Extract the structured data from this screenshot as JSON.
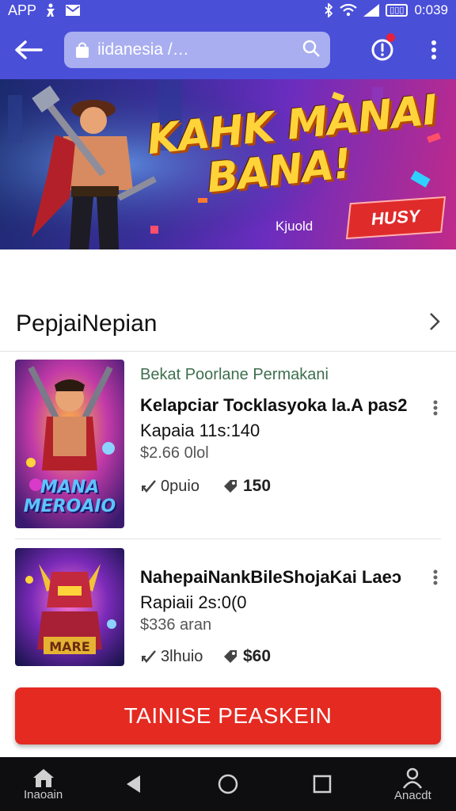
{
  "status_bar": {
    "app_label": "APP",
    "time": "0:039",
    "battery_label": "▯▯▯"
  },
  "toolbar": {
    "search_value": "iidanesia /…"
  },
  "banner": {
    "title_line1": "KAHK MANAI",
    "title_line2": "BANA!",
    "subtitle": "Kjuold",
    "badge": "HUSY"
  },
  "section": {
    "title": "PepjaiNepian"
  },
  "items": [
    {
      "category": "Bekat Poorlane Permakani",
      "name": "Kelapciar Tocklasyoka la.A pas2",
      "sub": "Kapaia 11s:140",
      "price": "$2.66 0lol",
      "likes": "0puio",
      "views": "150",
      "thumb_text": "MANA MEROAIO"
    },
    {
      "category": "",
      "name": "NahepaiNankBileShojaKai Laeɔ",
      "sub": "Rapiaii 2s:0(0",
      "price": "$336 aran",
      "likes": "3lhuio",
      "views": "$60",
      "thumb_text": "MARE"
    }
  ],
  "cta": {
    "label": "TAINISE PEASKEIN"
  },
  "nav": {
    "home_label": "Inaoain",
    "account_label": "Anacdt"
  },
  "colors": {
    "primary": "#4a4fd8",
    "cta": "#e52a21",
    "category": "#3e6f4e"
  }
}
